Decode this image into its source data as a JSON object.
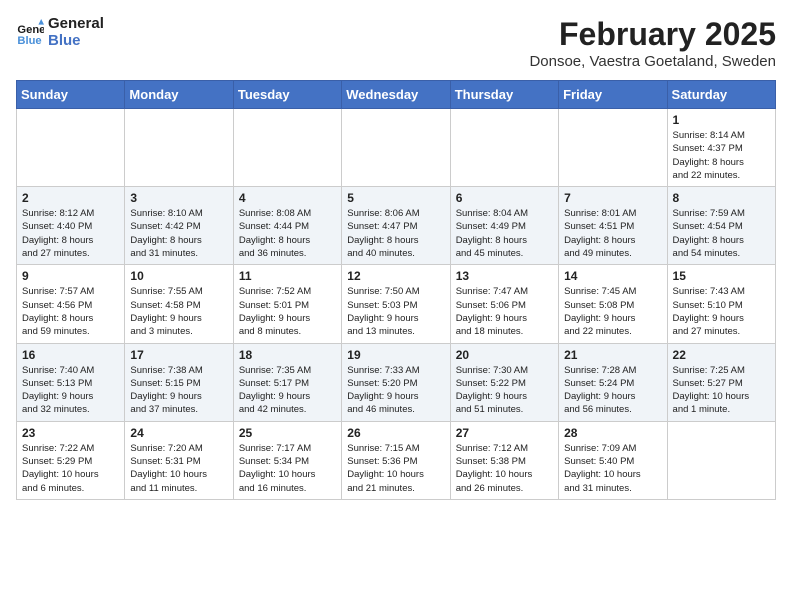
{
  "header": {
    "logo_general": "General",
    "logo_blue": "Blue",
    "month_title": "February 2025",
    "subtitle": "Donsoe, Vaestra Goetaland, Sweden"
  },
  "days_of_week": [
    "Sunday",
    "Monday",
    "Tuesday",
    "Wednesday",
    "Thursday",
    "Friday",
    "Saturday"
  ],
  "weeks": [
    [
      {
        "day": "",
        "info": ""
      },
      {
        "day": "",
        "info": ""
      },
      {
        "day": "",
        "info": ""
      },
      {
        "day": "",
        "info": ""
      },
      {
        "day": "",
        "info": ""
      },
      {
        "day": "",
        "info": ""
      },
      {
        "day": "1",
        "info": "Sunrise: 8:14 AM\nSunset: 4:37 PM\nDaylight: 8 hours\nand 22 minutes."
      }
    ],
    [
      {
        "day": "2",
        "info": "Sunrise: 8:12 AM\nSunset: 4:40 PM\nDaylight: 8 hours\nand 27 minutes."
      },
      {
        "day": "3",
        "info": "Sunrise: 8:10 AM\nSunset: 4:42 PM\nDaylight: 8 hours\nand 31 minutes."
      },
      {
        "day": "4",
        "info": "Sunrise: 8:08 AM\nSunset: 4:44 PM\nDaylight: 8 hours\nand 36 minutes."
      },
      {
        "day": "5",
        "info": "Sunrise: 8:06 AM\nSunset: 4:47 PM\nDaylight: 8 hours\nand 40 minutes."
      },
      {
        "day": "6",
        "info": "Sunrise: 8:04 AM\nSunset: 4:49 PM\nDaylight: 8 hours\nand 45 minutes."
      },
      {
        "day": "7",
        "info": "Sunrise: 8:01 AM\nSunset: 4:51 PM\nDaylight: 8 hours\nand 49 minutes."
      },
      {
        "day": "8",
        "info": "Sunrise: 7:59 AM\nSunset: 4:54 PM\nDaylight: 8 hours\nand 54 minutes."
      }
    ],
    [
      {
        "day": "9",
        "info": "Sunrise: 7:57 AM\nSunset: 4:56 PM\nDaylight: 8 hours\nand 59 minutes."
      },
      {
        "day": "10",
        "info": "Sunrise: 7:55 AM\nSunset: 4:58 PM\nDaylight: 9 hours\nand 3 minutes."
      },
      {
        "day": "11",
        "info": "Sunrise: 7:52 AM\nSunset: 5:01 PM\nDaylight: 9 hours\nand 8 minutes."
      },
      {
        "day": "12",
        "info": "Sunrise: 7:50 AM\nSunset: 5:03 PM\nDaylight: 9 hours\nand 13 minutes."
      },
      {
        "day": "13",
        "info": "Sunrise: 7:47 AM\nSunset: 5:06 PM\nDaylight: 9 hours\nand 18 minutes."
      },
      {
        "day": "14",
        "info": "Sunrise: 7:45 AM\nSunset: 5:08 PM\nDaylight: 9 hours\nand 22 minutes."
      },
      {
        "day": "15",
        "info": "Sunrise: 7:43 AM\nSunset: 5:10 PM\nDaylight: 9 hours\nand 27 minutes."
      }
    ],
    [
      {
        "day": "16",
        "info": "Sunrise: 7:40 AM\nSunset: 5:13 PM\nDaylight: 9 hours\nand 32 minutes."
      },
      {
        "day": "17",
        "info": "Sunrise: 7:38 AM\nSunset: 5:15 PM\nDaylight: 9 hours\nand 37 minutes."
      },
      {
        "day": "18",
        "info": "Sunrise: 7:35 AM\nSunset: 5:17 PM\nDaylight: 9 hours\nand 42 minutes."
      },
      {
        "day": "19",
        "info": "Sunrise: 7:33 AM\nSunset: 5:20 PM\nDaylight: 9 hours\nand 46 minutes."
      },
      {
        "day": "20",
        "info": "Sunrise: 7:30 AM\nSunset: 5:22 PM\nDaylight: 9 hours\nand 51 minutes."
      },
      {
        "day": "21",
        "info": "Sunrise: 7:28 AM\nSunset: 5:24 PM\nDaylight: 9 hours\nand 56 minutes."
      },
      {
        "day": "22",
        "info": "Sunrise: 7:25 AM\nSunset: 5:27 PM\nDaylight: 10 hours\nand 1 minute."
      }
    ],
    [
      {
        "day": "23",
        "info": "Sunrise: 7:22 AM\nSunset: 5:29 PM\nDaylight: 10 hours\nand 6 minutes."
      },
      {
        "day": "24",
        "info": "Sunrise: 7:20 AM\nSunset: 5:31 PM\nDaylight: 10 hours\nand 11 minutes."
      },
      {
        "day": "25",
        "info": "Sunrise: 7:17 AM\nSunset: 5:34 PM\nDaylight: 10 hours\nand 16 minutes."
      },
      {
        "day": "26",
        "info": "Sunrise: 7:15 AM\nSunset: 5:36 PM\nDaylight: 10 hours\nand 21 minutes."
      },
      {
        "day": "27",
        "info": "Sunrise: 7:12 AM\nSunset: 5:38 PM\nDaylight: 10 hours\nand 26 minutes."
      },
      {
        "day": "28",
        "info": "Sunrise: 7:09 AM\nSunset: 5:40 PM\nDaylight: 10 hours\nand 31 minutes."
      },
      {
        "day": "",
        "info": ""
      }
    ]
  ]
}
